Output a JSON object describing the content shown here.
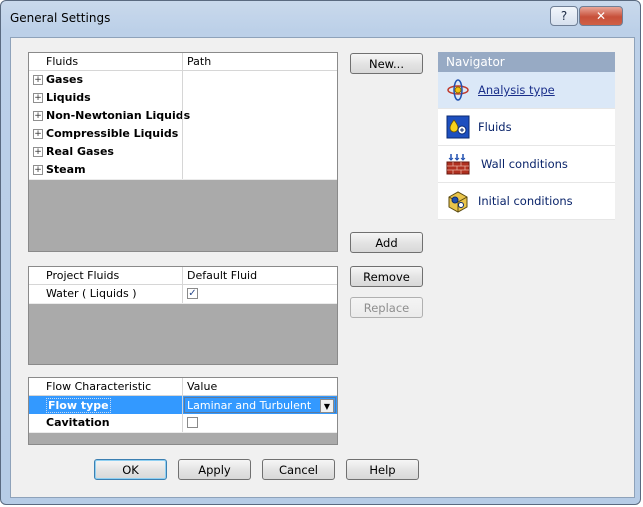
{
  "window": {
    "title": "General Settings",
    "help_glyph": "?",
    "close_glyph": "✕"
  },
  "fluids_table": {
    "col_fluids": "Fluids",
    "col_path": "Path",
    "rows": [
      "Gases",
      "Liquids",
      "Non-Newtonian Liquids",
      "Compressible Liquids",
      "Real Gases",
      "Steam"
    ]
  },
  "project_fluids_table": {
    "col_project": "Project Fluids",
    "col_default": "Default Fluid",
    "rows": [
      {
        "name": "Water ( Liquids )",
        "default_checked": true
      }
    ]
  },
  "flow_table": {
    "col_characteristic": "Flow Characteristic",
    "col_value": "Value",
    "rows": [
      {
        "name": "Flow type",
        "value": "Laminar and Turbulent",
        "selected": true
      },
      {
        "name": "Cavitation",
        "value": "",
        "checked": false
      }
    ]
  },
  "buttons": {
    "new": "New...",
    "add": "Add",
    "remove": "Remove",
    "replace": "Replace",
    "ok": "OK",
    "apply": "Apply",
    "cancel": "Cancel",
    "help": "Help"
  },
  "navigator": {
    "title": "Navigator",
    "items": [
      {
        "label": "Analysis type",
        "icon": "analysis-type-icon",
        "active": true
      },
      {
        "label": "Fluids",
        "icon": "fluids-icon",
        "active": false
      },
      {
        "label": "Wall conditions",
        "icon": "wall-conditions-icon",
        "active": false
      },
      {
        "label": "Initial conditions",
        "icon": "initial-conditions-icon",
        "active": false
      }
    ]
  },
  "colors": {
    "title_bar": "#bcd0e8",
    "selection": "#3399ff",
    "navigator_header": "#97aac4",
    "close_button": "#c7503a"
  }
}
